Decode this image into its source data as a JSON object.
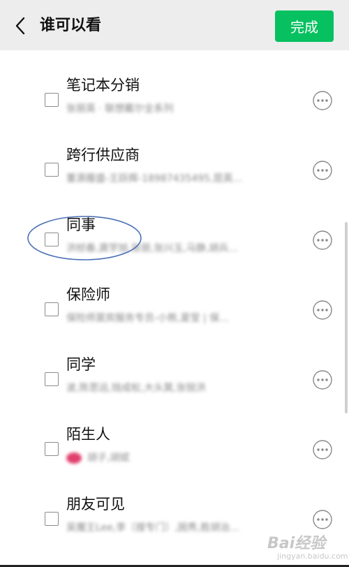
{
  "header": {
    "title": "谁可以看",
    "done_label": "完成",
    "back_icon": "chevron-left-icon"
  },
  "colors": {
    "accent": "#07c160",
    "header_bg": "#ededed",
    "annotation": "#4a6fb5"
  },
  "groups": [
    {
      "name": "笔记本分销",
      "members": "张丽英 · 联想戴尔全系列",
      "checked": false
    },
    {
      "name": "跨行供应商",
      "members": "董源履盛-王跃辉-18987435495,昆英…",
      "checked": false
    },
    {
      "name": "同事",
      "members": "洪桢春,龚学旭,张丽,张兴玉,马静,胡兵…",
      "checked": false
    },
    {
      "name": "保险师",
      "members": "保险师莫宾服务专员-小熊,夏莹 | 保…",
      "checked": false
    },
    {
      "name": "同学",
      "members": "波,陈思远,钱成松,大头箕,张锐洪",
      "checked": false
    },
    {
      "name": "陌生人",
      "members": "胡子,胡斌",
      "checked": false,
      "has_avatar": true
    },
    {
      "name": "朋友可见",
      "members": "吴魔王Lee,李〔搜专门〕,困秀,胜胡治…",
      "checked": false
    }
  ],
  "watermark": {
    "main": "Bai经验",
    "sub": "jingyan.baidu.com"
  }
}
